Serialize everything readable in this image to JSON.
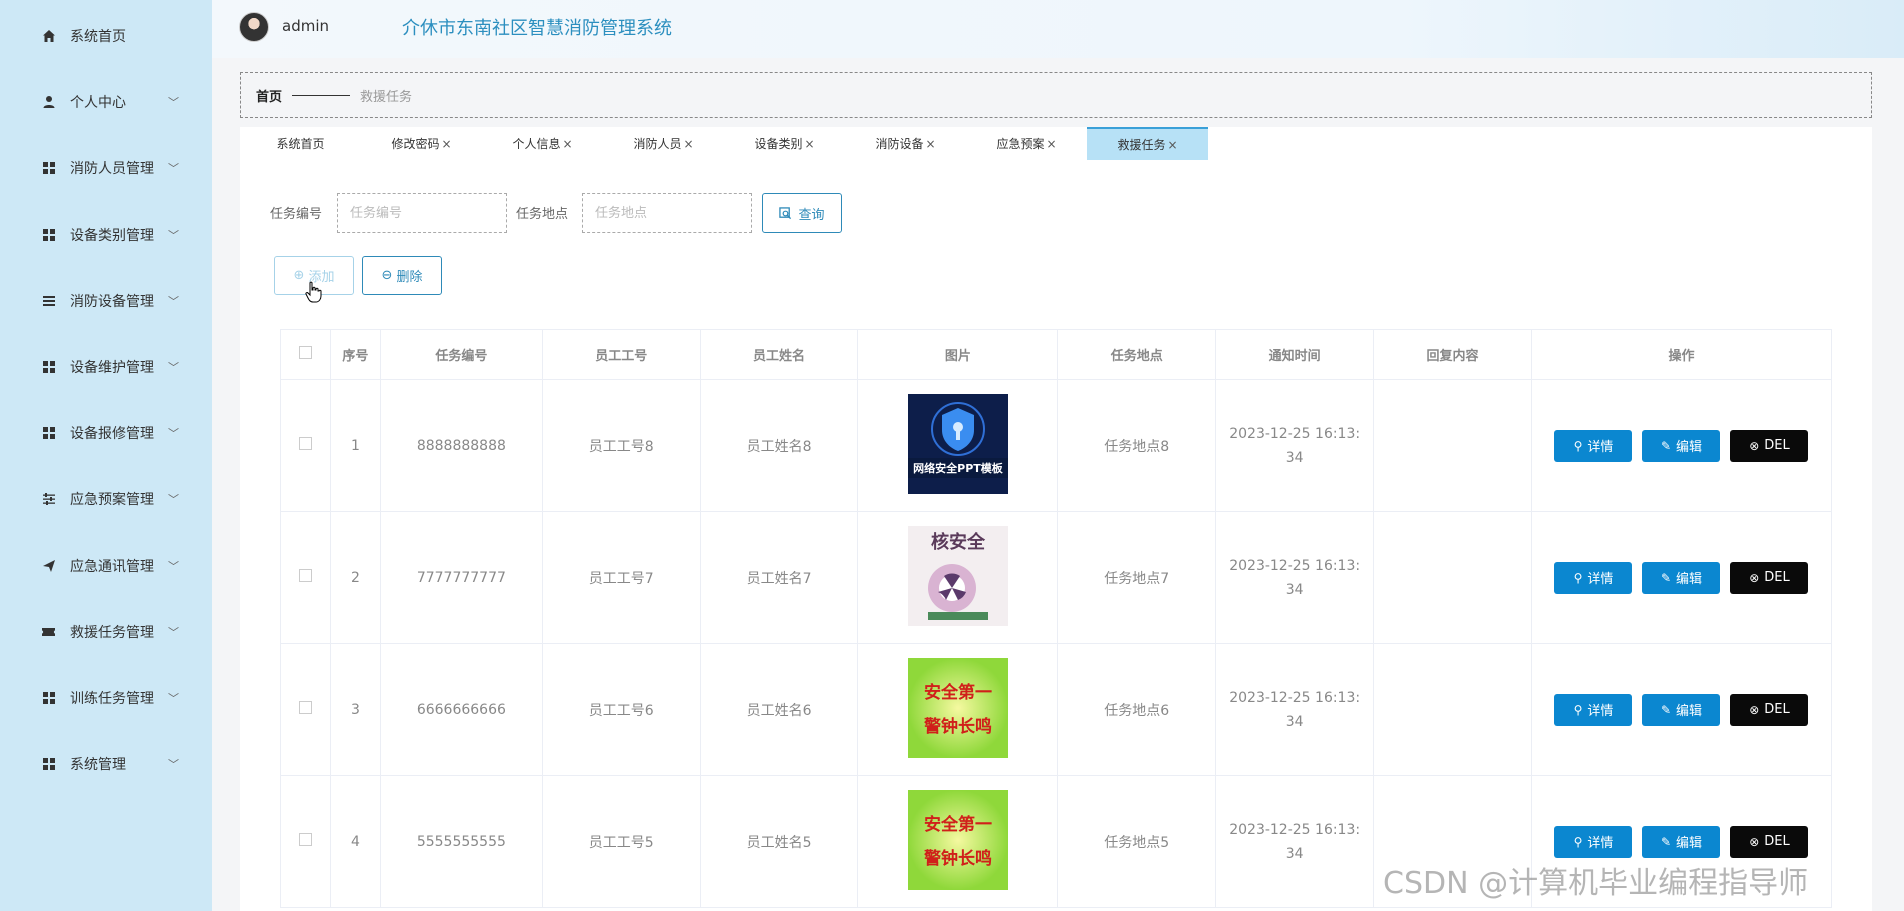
{
  "sidebar": {
    "items": [
      {
        "label": "系统首页",
        "icon": "home-icon",
        "chevron": false
      },
      {
        "label": "个人中心",
        "icon": "user-icon",
        "chevron": true
      },
      {
        "label": "消防人员管理",
        "icon": "grid-icon",
        "chevron": true
      },
      {
        "label": "设备类别管理",
        "icon": "grid-icon",
        "chevron": true
      },
      {
        "label": "消防设备管理",
        "icon": "list-icon",
        "chevron": true
      },
      {
        "label": "设备维护管理",
        "icon": "grid-icon",
        "chevron": true
      },
      {
        "label": "设备报修管理",
        "icon": "grid-icon",
        "chevron": true
      },
      {
        "label": "应急预案管理",
        "icon": "sliders-icon",
        "chevron": true
      },
      {
        "label": "应急通讯管理",
        "icon": "send-icon",
        "chevron": true
      },
      {
        "label": "救援任务管理",
        "icon": "ticket-icon",
        "chevron": true
      },
      {
        "label": "训练任务管理",
        "icon": "grid-icon",
        "chevron": true
      },
      {
        "label": "系统管理",
        "icon": "grid-icon",
        "chevron": true
      }
    ]
  },
  "header": {
    "username": "admin",
    "title": "介休市东南社区智慧消防管理系统"
  },
  "breadcrumb": {
    "home": "首页",
    "current": "救援任务"
  },
  "tabs": [
    {
      "label": "系统首页",
      "closable": false
    },
    {
      "label": "修改密码",
      "closable": true
    },
    {
      "label": "个人信息",
      "closable": true
    },
    {
      "label": "消防人员",
      "closable": true
    },
    {
      "label": "设备类别",
      "closable": true
    },
    {
      "label": "消防设备",
      "closable": true
    },
    {
      "label": "应急预案",
      "closable": true
    },
    {
      "label": "救援任务",
      "closable": true,
      "active": true
    }
  ],
  "search": {
    "task_no_label": "任务编号",
    "task_no_placeholder": "任务编号",
    "location_label": "任务地点",
    "location_placeholder": "任务地点",
    "query_label": "查询"
  },
  "actions": {
    "add_label": "添加",
    "delete_label": "删除"
  },
  "table": {
    "headers": [
      "序号",
      "任务编号",
      "员工工号",
      "员工姓名",
      "图片",
      "任务地点",
      "通知时间",
      "回复内容",
      "操作"
    ],
    "rows": [
      {
        "index": "1",
        "task_no": "8888888888",
        "emp_no": "员工工号8",
        "emp_name": "员工姓名8",
        "image": "网络安全PPT模板",
        "location": "任务地点8",
        "time": "2023-12-25 16:13:34",
        "reply": ""
      },
      {
        "index": "2",
        "task_no": "7777777777",
        "emp_no": "员工工号7",
        "emp_name": "员工姓名7",
        "image": "核安全",
        "location": "任务地点7",
        "time": "2023-12-25 16:13:34",
        "reply": ""
      },
      {
        "index": "3",
        "task_no": "6666666666",
        "emp_no": "员工工号6",
        "emp_name": "员工姓名6",
        "image": "安全第一 警钟长鸣",
        "location": "任务地点6",
        "time": "2023-12-25 16:13:34",
        "reply": ""
      },
      {
        "index": "4",
        "task_no": "5555555555",
        "emp_no": "员工工号5",
        "emp_name": "员工姓名5",
        "image": "安全第一 警钟长鸣",
        "location": "任务地点5",
        "time": "2023-12-25 16:13:34",
        "reply": ""
      }
    ],
    "op_detail": "详情",
    "op_edit": "编辑",
    "op_delete": "DEL"
  },
  "watermark": "CSDN @计算机毕业编程指导师",
  "colors": {
    "sidebar": "#cde8f6",
    "accent": "#2e8ab8",
    "primary_btn": "#0b87d0",
    "danger_btn": "#0a0a0a"
  }
}
